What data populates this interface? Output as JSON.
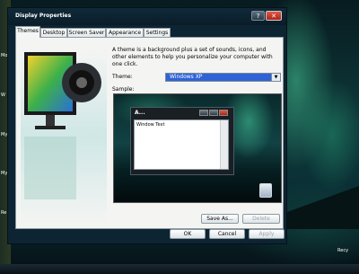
{
  "window": {
    "title": "Display Properties",
    "help_label": "?",
    "close_label": "✕"
  },
  "tabs": [
    {
      "label": "Themes",
      "active": true
    },
    {
      "label": "Desktop",
      "active": false
    },
    {
      "label": "Screen Saver",
      "active": false
    },
    {
      "label": "Appearance",
      "active": false
    },
    {
      "label": "Settings",
      "active": false
    }
  ],
  "themes_panel": {
    "description": "A theme is a background plus a set of sounds, icons, and other elements to help you personalize your computer with one click.",
    "theme_label": "Theme:",
    "theme_value": "Windows XP",
    "sample_label": "Sample:",
    "sample_window_title": "A...",
    "sample_window_text": "Window Text",
    "save_as_label": "Save As...",
    "delete_label": "Delete"
  },
  "buttons": {
    "ok": "OK",
    "cancel": "Cancel",
    "apply": "Apply"
  },
  "desktop": {
    "labels": [
      "Mo",
      "W",
      "My",
      "My",
      "Re"
    ],
    "recycle_label": "Recy"
  }
}
